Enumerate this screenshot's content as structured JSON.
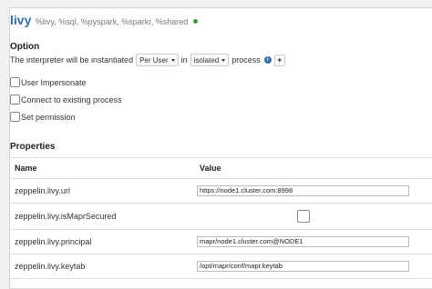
{
  "interpreter": {
    "name": "livy",
    "bindings": "%livy, %sql, %pyspark, %sparkr, %shared",
    "status_color": "#3c9a3c"
  },
  "option": {
    "heading": "Option",
    "instantiate_prefix": "The interpreter will be instantiated",
    "mode_selected": "Per User",
    "in_label": "in",
    "process_selected": "isolated",
    "process_suffix": "process",
    "info_icon": "info-icon",
    "add_icon": "+",
    "checkboxes": [
      {
        "label": "User Impersonate",
        "checked": false
      },
      {
        "label": "Connect to existing process",
        "checked": false
      },
      {
        "label": "Set permission",
        "checked": false
      }
    ]
  },
  "properties": {
    "heading": "Properties",
    "columns": [
      "Name",
      "Value"
    ],
    "rows": [
      {
        "name": "zeppelin.livy.url",
        "value": "https://node1.cluster.com:8998"
      },
      {
        "name": "zeppelin.livy.isMaprSecured",
        "value": "",
        "checkbox": true
      },
      {
        "name": "zeppelin.livy.principal",
        "value": "mapr/node1.cluster.com@NODE1"
      },
      {
        "name": "zeppelin.livy.keytab",
        "value": "/opt/mapr/conf/mapr.keytab"
      }
    ]
  }
}
